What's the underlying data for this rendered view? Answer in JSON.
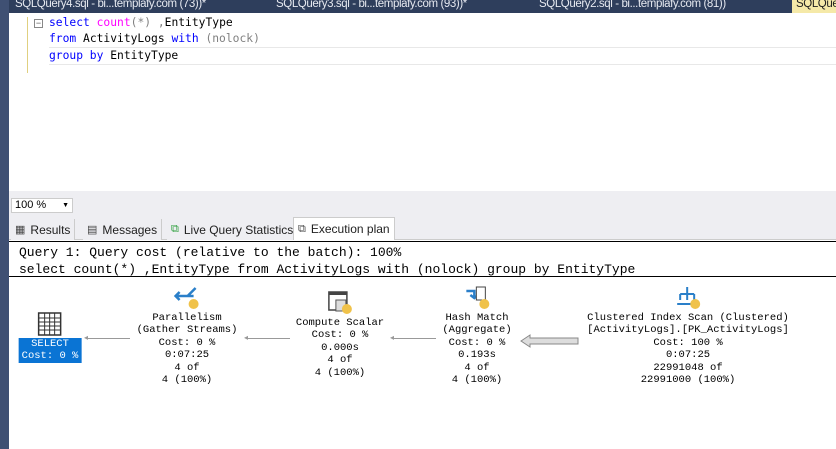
{
  "doc_tabs": [
    {
      "label": "SQLQuery4.sql - bi...templafy.com (73))*"
    },
    {
      "label": "SQLQuery3.sql - bi...templafy.com (93))*"
    },
    {
      "label": "SQLQuery2.sql - bi...templafy.com (81))"
    },
    {
      "label": "SQLQue"
    }
  ],
  "editor": {
    "line1": {
      "kw": "select",
      "fn": "count",
      "args": "(*)",
      "sep": " ,",
      "rest": "EntityType"
    },
    "line2": {
      "kw": "from",
      "table": " ActivityLogs ",
      "kw2": "with",
      "hint": " (nolock)"
    },
    "line3": {
      "kw": "group by",
      "rest": " EntityType"
    }
  },
  "zoom": "100 %",
  "result_tabs": [
    {
      "label": "Results"
    },
    {
      "label": "Messages"
    },
    {
      "label": "Live Query Statistics"
    },
    {
      "label": "Execution plan"
    }
  ],
  "plan": {
    "header1": "Query 1: Query cost (relative to the batch): 100%",
    "header2": "select count(*) ,EntityType from ActivityLogs with (nolock) group by EntityType",
    "nodes": [
      {
        "name": "SELECT",
        "cost": "Cost: 0 %"
      },
      {
        "name": "Parallelism",
        "sub": "(Gather Streams)",
        "cost": "Cost: 0 %",
        "time": "0:07:25",
        "rows1": "4 of",
        "rows2": "4 (100%)"
      },
      {
        "name": "Compute Scalar",
        "cost": "Cost: 0 %",
        "time": "0.000s",
        "rows1": "4 of",
        "rows2": "4 (100%)"
      },
      {
        "name": "Hash Match",
        "sub": "(Aggregate)",
        "cost": "Cost: 0 %",
        "time": "0.193s",
        "rows1": "4 of",
        "rows2": "4 (100%)"
      },
      {
        "name": "Clustered Index Scan (Clustered)",
        "sub": "[ActivityLogs].[PK_ActivityLogs]",
        "cost": "Cost: 100 %",
        "time": "0:07:25",
        "rows1": "22991048 of",
        "rows2": "22991000 (100%)"
      }
    ]
  }
}
